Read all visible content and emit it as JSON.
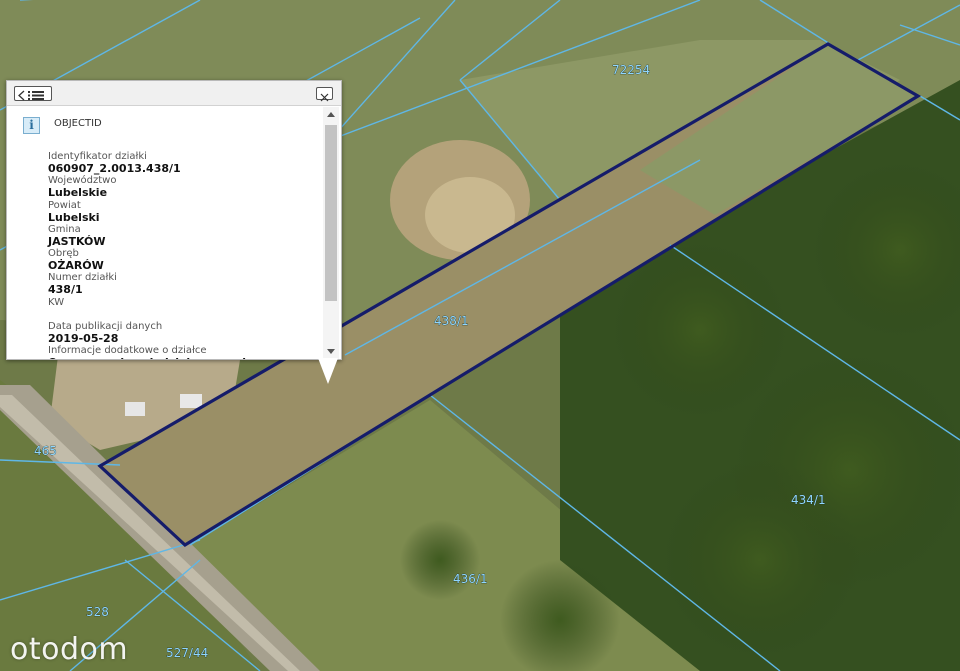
{
  "map": {
    "parcel_labels": {
      "p72254": "72254",
      "p438_1": "438/1",
      "p434_1": "434/1",
      "p436_1": "436/1",
      "p465": "465",
      "p528": "528",
      "p527_44": "527/44"
    },
    "colors": {
      "selected_outline": "#151c6a",
      "parcel_lines": "#5fb7e6",
      "label_text": "#8fd6ff"
    }
  },
  "popup": {
    "title": "OBJECTID",
    "info_icon": "i",
    "menu_icon": "list-menu-icon",
    "close_icon": "close-icon",
    "attributes": [
      {
        "key": "Identyfikator działki",
        "value": "060907_2.0013.438/1"
      },
      {
        "key": "Województwo",
        "value": "Lubelskie"
      },
      {
        "key": "Powiat",
        "value": "Lubelski"
      },
      {
        "key": "Gmina",
        "value": "JASTKÓW"
      },
      {
        "key": "Obręb",
        "value": "OŻARÓW"
      },
      {
        "key": "Numer działki",
        "value": "438/1"
      },
      {
        "key": "KW",
        "value": ""
      },
      {
        "key": "Data publikacji danych",
        "value": "2019-05-28"
      },
      {
        "key": "Informacje dodatkowe o działce",
        "value": "Organem odpowiedzialnym za dane"
      }
    ]
  },
  "watermark": {
    "text": "otodom"
  }
}
